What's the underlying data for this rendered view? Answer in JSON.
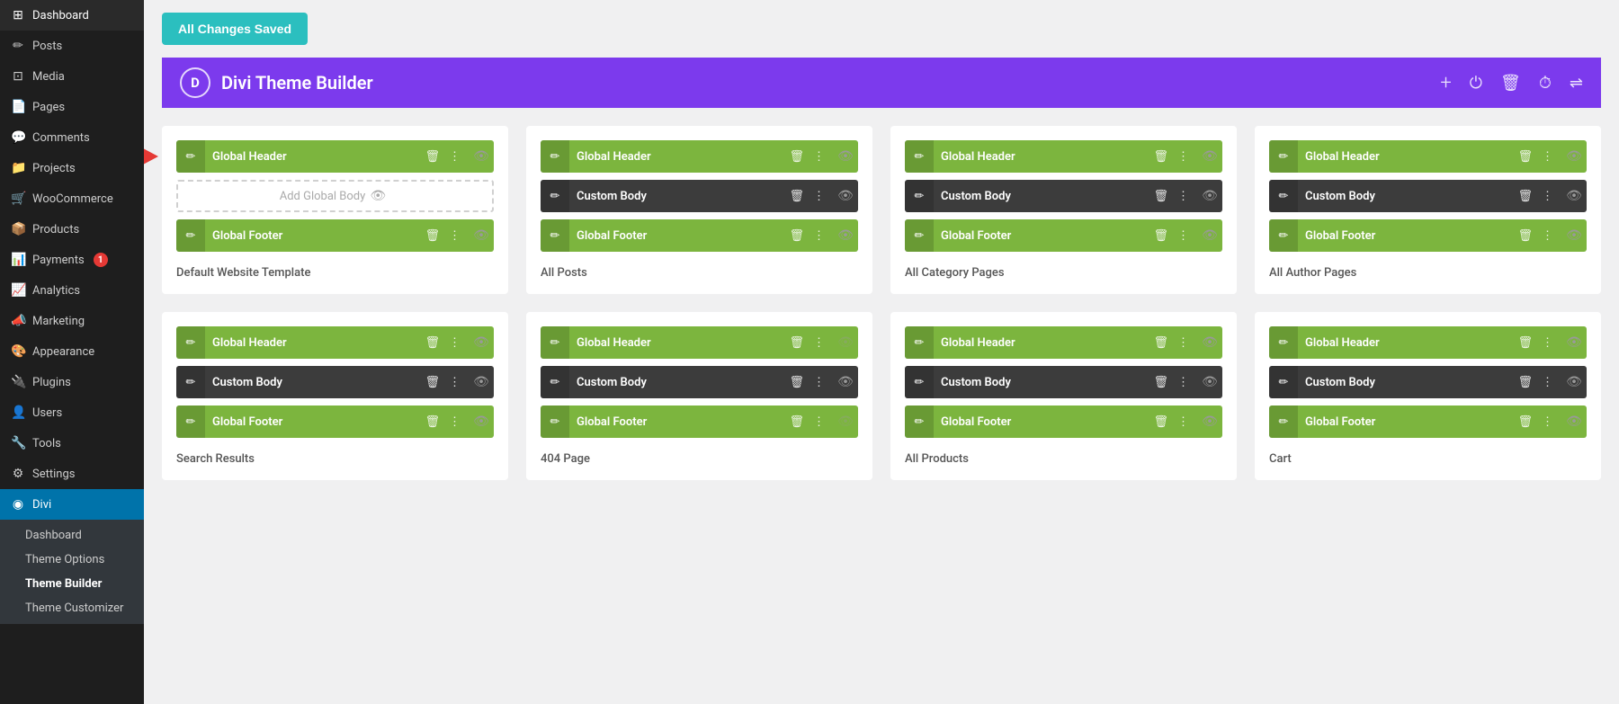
{
  "sidebar": {
    "items": [
      {
        "id": "dashboard",
        "label": "Dashboard",
        "icon": "⊞"
      },
      {
        "id": "posts",
        "label": "Posts",
        "icon": "✏"
      },
      {
        "id": "media",
        "label": "Media",
        "icon": "⊡"
      },
      {
        "id": "pages",
        "label": "Pages",
        "icon": "📄"
      },
      {
        "id": "comments",
        "label": "Comments",
        "icon": "💬"
      },
      {
        "id": "projects",
        "label": "Projects",
        "icon": "📁"
      },
      {
        "id": "woocommerce",
        "label": "WooCommerce",
        "icon": "🛒"
      },
      {
        "id": "products",
        "label": "Products",
        "icon": "📦"
      },
      {
        "id": "payments",
        "label": "Payments",
        "icon": "📊",
        "badge": "1"
      },
      {
        "id": "analytics",
        "label": "Analytics",
        "icon": "📈"
      },
      {
        "id": "marketing",
        "label": "Marketing",
        "icon": "📣"
      },
      {
        "id": "appearance",
        "label": "Appearance",
        "icon": "🎨"
      },
      {
        "id": "plugins",
        "label": "Plugins",
        "icon": "🔌"
      },
      {
        "id": "users",
        "label": "Users",
        "icon": "👤"
      },
      {
        "id": "tools",
        "label": "Tools",
        "icon": "🔧"
      },
      {
        "id": "settings",
        "label": "Settings",
        "icon": "⚙"
      },
      {
        "id": "divi",
        "label": "Divi",
        "icon": "◉",
        "active": true
      }
    ],
    "sub_items": [
      {
        "id": "dashboard-sub",
        "label": "Dashboard"
      },
      {
        "id": "theme-options",
        "label": "Theme Options"
      },
      {
        "id": "theme-builder",
        "label": "Theme Builder",
        "active": true
      },
      {
        "id": "theme-customizer",
        "label": "Theme Customizer"
      }
    ]
  },
  "topbar": {
    "saved_label": "All Changes Saved"
  },
  "builder": {
    "logo": "D",
    "title": "Divi Theme Builder",
    "actions": {
      "add": "+",
      "power": "⏻",
      "trash": "🗑",
      "history": "⏱",
      "settings": "⇌"
    }
  },
  "cards": [
    {
      "id": "card-1",
      "has_arrow": true,
      "rows": [
        {
          "type": "green",
          "label": "Global Header",
          "has_eye": true,
          "eye_active": true
        },
        {
          "type": "dashed",
          "label": "Add Global Body",
          "has_eye": true
        },
        {
          "type": "green",
          "label": "Global Footer",
          "has_eye": true,
          "eye_active": true
        }
      ],
      "template_label": "Default Website Template"
    },
    {
      "id": "card-2",
      "rows": [
        {
          "type": "green",
          "label": "Global Header",
          "has_eye": true,
          "eye_active": true
        },
        {
          "type": "dark",
          "label": "Custom Body",
          "has_eye": true,
          "eye_active": true
        },
        {
          "type": "green",
          "label": "Global Footer",
          "has_eye": true,
          "eye_active": true
        }
      ],
      "template_label": "All Posts"
    },
    {
      "id": "card-3",
      "rows": [
        {
          "type": "green",
          "label": "Global Header",
          "has_eye": true,
          "eye_active": true
        },
        {
          "type": "dark",
          "label": "Custom Body",
          "has_eye": true,
          "eye_active": true
        },
        {
          "type": "green",
          "label": "Global Footer",
          "has_eye": true,
          "eye_active": true
        }
      ],
      "template_label": "All Category Pages"
    },
    {
      "id": "card-4",
      "rows": [
        {
          "type": "green",
          "label": "Global Header",
          "has_eye": true,
          "eye_active": true
        },
        {
          "type": "dark",
          "label": "Custom Body",
          "has_eye": true,
          "eye_active": true
        },
        {
          "type": "green",
          "label": "Global Footer",
          "has_eye": true,
          "eye_active": true
        }
      ],
      "template_label": "All Author Pages"
    },
    {
      "id": "card-5",
      "rows": [
        {
          "type": "green",
          "label": "Global Header",
          "has_eye": true,
          "eye_active": true
        },
        {
          "type": "dark",
          "label": "Custom Body",
          "has_eye": true,
          "eye_active": true
        },
        {
          "type": "green",
          "label": "Global Footer",
          "has_eye": true,
          "eye_active": true
        }
      ],
      "template_label": "Search Results"
    },
    {
      "id": "card-6",
      "rows": [
        {
          "type": "green",
          "label": "Global Header",
          "has_eye": true,
          "eye_active": false
        },
        {
          "type": "dark",
          "label": "Custom Body",
          "has_eye": true,
          "eye_active": true
        },
        {
          "type": "green",
          "label": "Global Footer",
          "has_eye": true,
          "eye_active": false
        }
      ],
      "template_label": "404 Page"
    },
    {
      "id": "card-7",
      "rows": [
        {
          "type": "green",
          "label": "Global Header",
          "has_eye": true,
          "eye_active": true
        },
        {
          "type": "dark",
          "label": "Custom Body",
          "has_eye": true,
          "eye_active": true
        },
        {
          "type": "green",
          "label": "Global Footer",
          "has_eye": true,
          "eye_active": true
        }
      ],
      "template_label": "All Products"
    },
    {
      "id": "card-8",
      "rows": [
        {
          "type": "green",
          "label": "Global Header",
          "has_eye": true,
          "eye_active": true
        },
        {
          "type": "dark",
          "label": "Custom Body",
          "has_eye": true,
          "eye_active": true
        },
        {
          "type": "green",
          "label": "Global Footer",
          "has_eye": true,
          "eye_active": true
        }
      ],
      "template_label": "Cart"
    }
  ]
}
